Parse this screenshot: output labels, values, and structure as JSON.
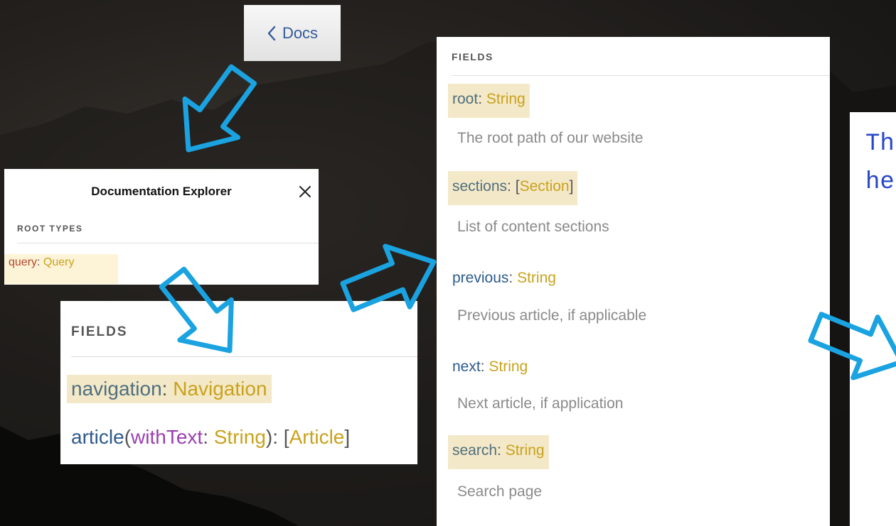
{
  "docs_button": {
    "label": "Docs",
    "icon": "chevron-left-icon"
  },
  "explorer": {
    "title": "Documentation Explorer",
    "close_icon": "close-icon",
    "section_label": "ROOT TYPES",
    "root_field": {
      "name": "query",
      "sep": ": ",
      "type": "Query"
    }
  },
  "fields_small": {
    "section_label": "FIELDS",
    "navigation": {
      "name": "navigation",
      "sep": ": ",
      "type": "Navigation"
    },
    "article": {
      "name": "article",
      "open_paren": "(",
      "arg_name": "withText",
      "arg_sep": ": ",
      "arg_type": "String",
      "close_paren": "): ",
      "open_bracket": "[",
      "type": "Article",
      "close_bracket": "]"
    }
  },
  "fields_large": {
    "section_label": "FIELDS",
    "fields": [
      {
        "name": "root",
        "sep": ": ",
        "open_bracket": "",
        "type": "String",
        "close_bracket": "",
        "description": "The root path of our website"
      },
      {
        "name": "sections",
        "sep": ": ",
        "open_bracket": "[",
        "type": "Section",
        "close_bracket": "]",
        "description": "List of content sections"
      },
      {
        "name": "previous",
        "sep": ": ",
        "open_bracket": "",
        "type": "String",
        "close_bracket": "",
        "description": "Previous article, if applicable"
      },
      {
        "name": "next",
        "sep": ": ",
        "open_bracket": "",
        "type": "String",
        "close_bracket": "",
        "description": "Next article, if application"
      },
      {
        "name": "search",
        "sep": ": ",
        "open_bracket": "",
        "type": "String",
        "close_bracket": "",
        "description": "Search page"
      }
    ]
  },
  "right_panel": {
    "line1": "Th",
    "line2": "he"
  },
  "colors": {
    "field_name": "#4f6f7f",
    "field_name_blue": "#2d5a8c",
    "type": "#c9a21c",
    "argument": "#9a3fb0",
    "query_name": "#b6452c",
    "highlight": "#f3e8c7",
    "arrow_stroke": "#1aa3e0",
    "right_panel_text": "#2747c9"
  }
}
